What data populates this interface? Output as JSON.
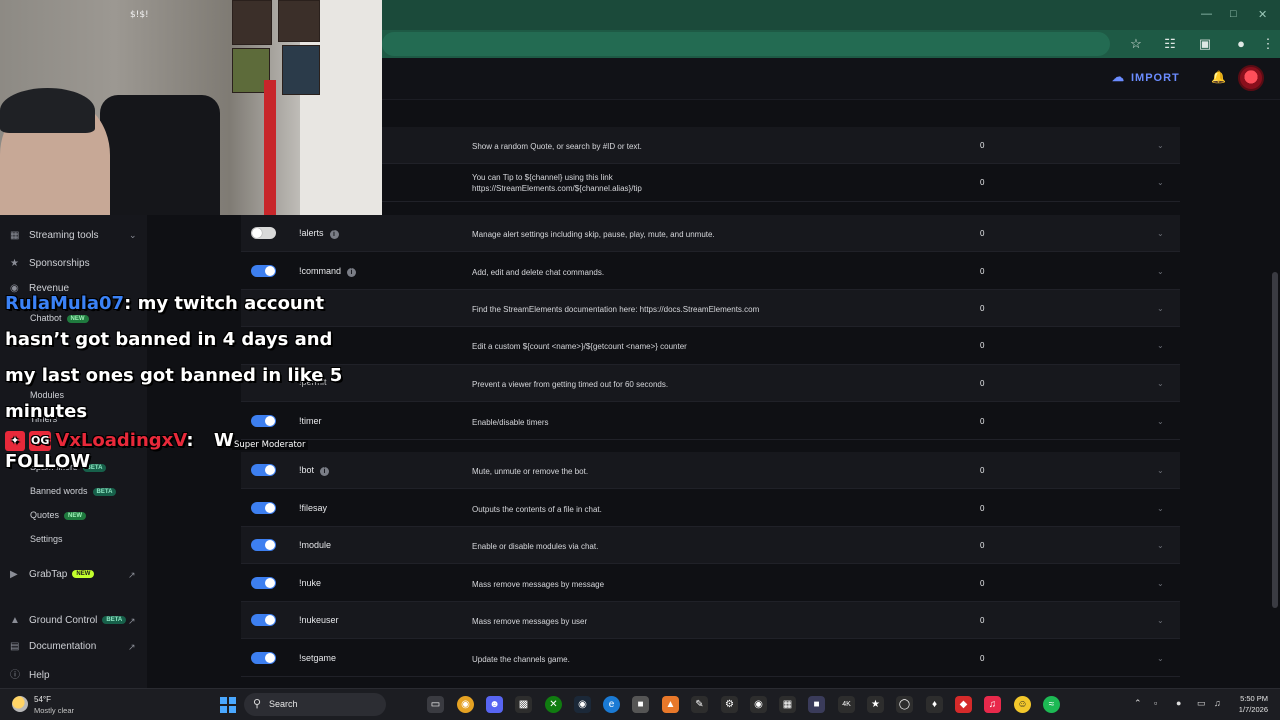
{
  "header": {
    "import_label": "IMPORT"
  },
  "sidebar": {
    "streaming_tools": "Streaming tools",
    "sponsorships": "Sponsorships",
    "revenue": "Revenue",
    "chatbot": "Chatbot",
    "chatbot_badge": "NEW",
    "sub": {
      "modules": "Modules",
      "timers": "Timers",
      "spam_filters": "Spam filters",
      "spam_badge": "BETA",
      "banned_words": "Banned words",
      "banned_badge": "BETA",
      "quotes": "Quotes",
      "quotes_badge": "NEW",
      "settings": "Settings"
    },
    "graptap": "GrabTap",
    "graptap_badge": "NEW",
    "ground_control": "Ground Control",
    "ground_badge": "BETA",
    "documentation": "Documentation",
    "help": "Help"
  },
  "rows": [
    {
      "cmd": "",
      "desc": "Show a random Quote, or search by #ID or text.",
      "count": "0"
    },
    {
      "cmd": "",
      "desc": "You can Tip to ${channel} using this link",
      "desc2": "https://StreamElements.com/${channel.alias}/tip",
      "count": "0"
    },
    {
      "cmd": "!alerts",
      "desc": "Manage alert settings including skip, pause, play, mute, and unmute.",
      "count": "0"
    },
    {
      "cmd": "!command",
      "desc": "Add, edit and delete chat commands.",
      "count": "0"
    },
    {
      "cmd": "",
      "desc": "Find the StreamElements documentation here: https://docs.StreamElements.com",
      "count": "0"
    },
    {
      "cmd": "",
      "desc": "Edit a custom ${count <name>}/${getcount <name>} counter",
      "count": "0"
    },
    {
      "cmd": "!permit",
      "desc": "Prevent a viewer from getting timed out for 60 seconds.",
      "count": "0"
    },
    {
      "cmd": "!timer",
      "desc": "Enable/disable timers",
      "count": "0"
    },
    {
      "cmd": "!bot",
      "desc": "Mute, unmute or remove the bot.",
      "count": "0"
    },
    {
      "cmd": "!filesay",
      "desc": "Outputs the contents of a file in chat.",
      "count": "0"
    },
    {
      "cmd": "!module",
      "desc": "Enable or disable modules via chat.",
      "count": "0"
    },
    {
      "cmd": "!nuke",
      "desc": "Mass remove messages by message",
      "count": "0"
    },
    {
      "cmd": "!nukeuser",
      "desc": "Mass remove messages by user",
      "count": "0"
    },
    {
      "cmd": "!setgame",
      "desc": "Update the channels game.",
      "count": "0"
    }
  ],
  "chat": {
    "user1": "RulaMula07",
    "msg1_a": "my twitch account",
    "msg1_b": "hasn’t got banned in 4 days and",
    "msg1_c": "my last ones got banned in like 5",
    "msg1_d": "minutes",
    "badge2": "OG",
    "user2": "VxLoadingxV",
    "msg2": "W",
    "supermod": "Super Moderator",
    "follow": "FOLLOW"
  },
  "webcam": {
    "sign": "$!$!"
  },
  "taskbar": {
    "temp": "54°F",
    "weather": "Mostly clear",
    "search": "Search",
    "time": "5:50 PM",
    "date": "1/7/2026"
  }
}
